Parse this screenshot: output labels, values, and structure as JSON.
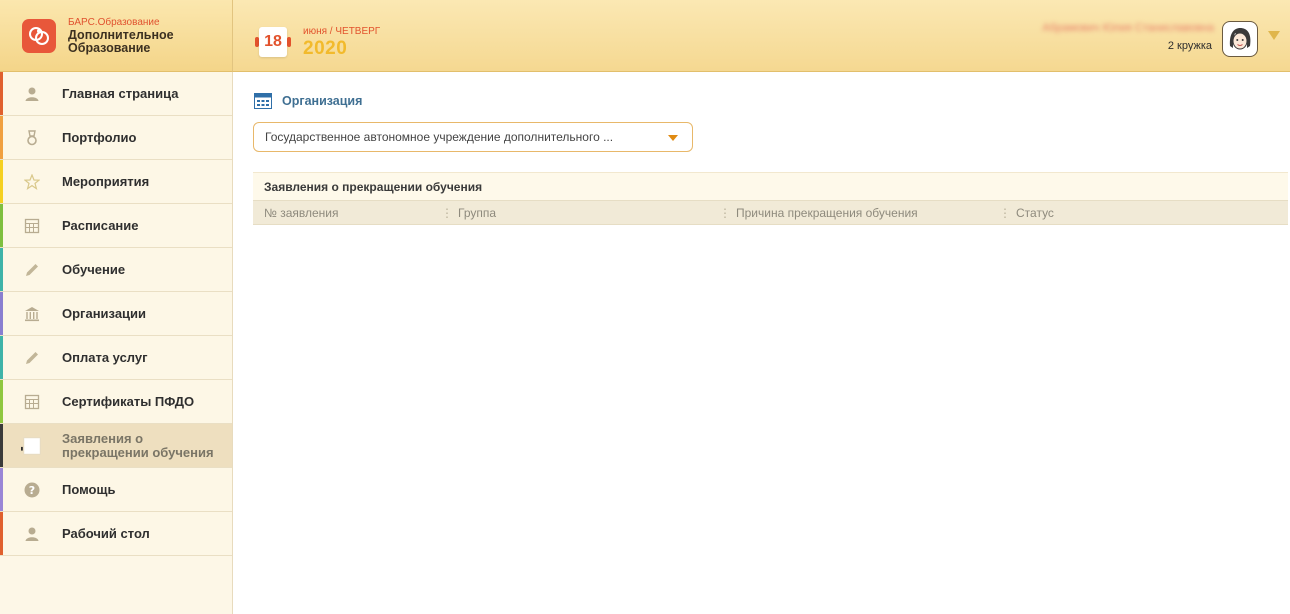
{
  "brand": {
    "line1": "БАРС.Образование",
    "line2": "Дополнительное",
    "line3": "Образование",
    "accent": "#e8573a"
  },
  "header": {
    "day": "18",
    "month_weekday": "июня / ЧЕТВЕРГ",
    "year": "2020",
    "user_name": "Абрамович Юлия Станиславовна",
    "user_count": "2 кружка"
  },
  "sidebar": {
    "items": [
      {
        "label": "Главная страница",
        "icon": "person-icon",
        "color": "#e0602e"
      },
      {
        "label": "Портфолио",
        "icon": "medal-icon",
        "color": "#f0a040"
      },
      {
        "label": "Мероприятия",
        "icon": "star-icon",
        "color": "#f5d020"
      },
      {
        "label": "Расписание",
        "icon": "calendar-grid-icon",
        "color": "#7fbf3f"
      },
      {
        "label": "Обучение",
        "icon": "pencil-icon",
        "color": "#3fb3a8"
      },
      {
        "label": "Организации",
        "icon": "building-icon",
        "color": "#8a7fd0"
      },
      {
        "label": "Оплата услуг",
        "icon": "pencil-icon",
        "color": "#3fb3a8"
      },
      {
        "label": "Сертификаты ПФДО",
        "icon": "calendar-grid-icon",
        "color": "#8fc73f"
      },
      {
        "label": "Заявления о прекращении обучения",
        "icon": "document-icon",
        "color": "#3a3a3a",
        "active": true
      },
      {
        "label": "Помощь",
        "icon": "help-icon",
        "color": "#9a86d6"
      },
      {
        "label": "Рабочий стол",
        "icon": "person-icon",
        "color": "#e0602e"
      }
    ]
  },
  "main": {
    "org_heading": "Организация",
    "org_select_value": "Государственное автономное учреждение дополнительного ...",
    "grid": {
      "title": "Заявления о прекращении обучения",
      "columns": [
        "№ заявления",
        "Группа",
        "Причина прекращения обучения",
        "Статус"
      ]
    }
  }
}
